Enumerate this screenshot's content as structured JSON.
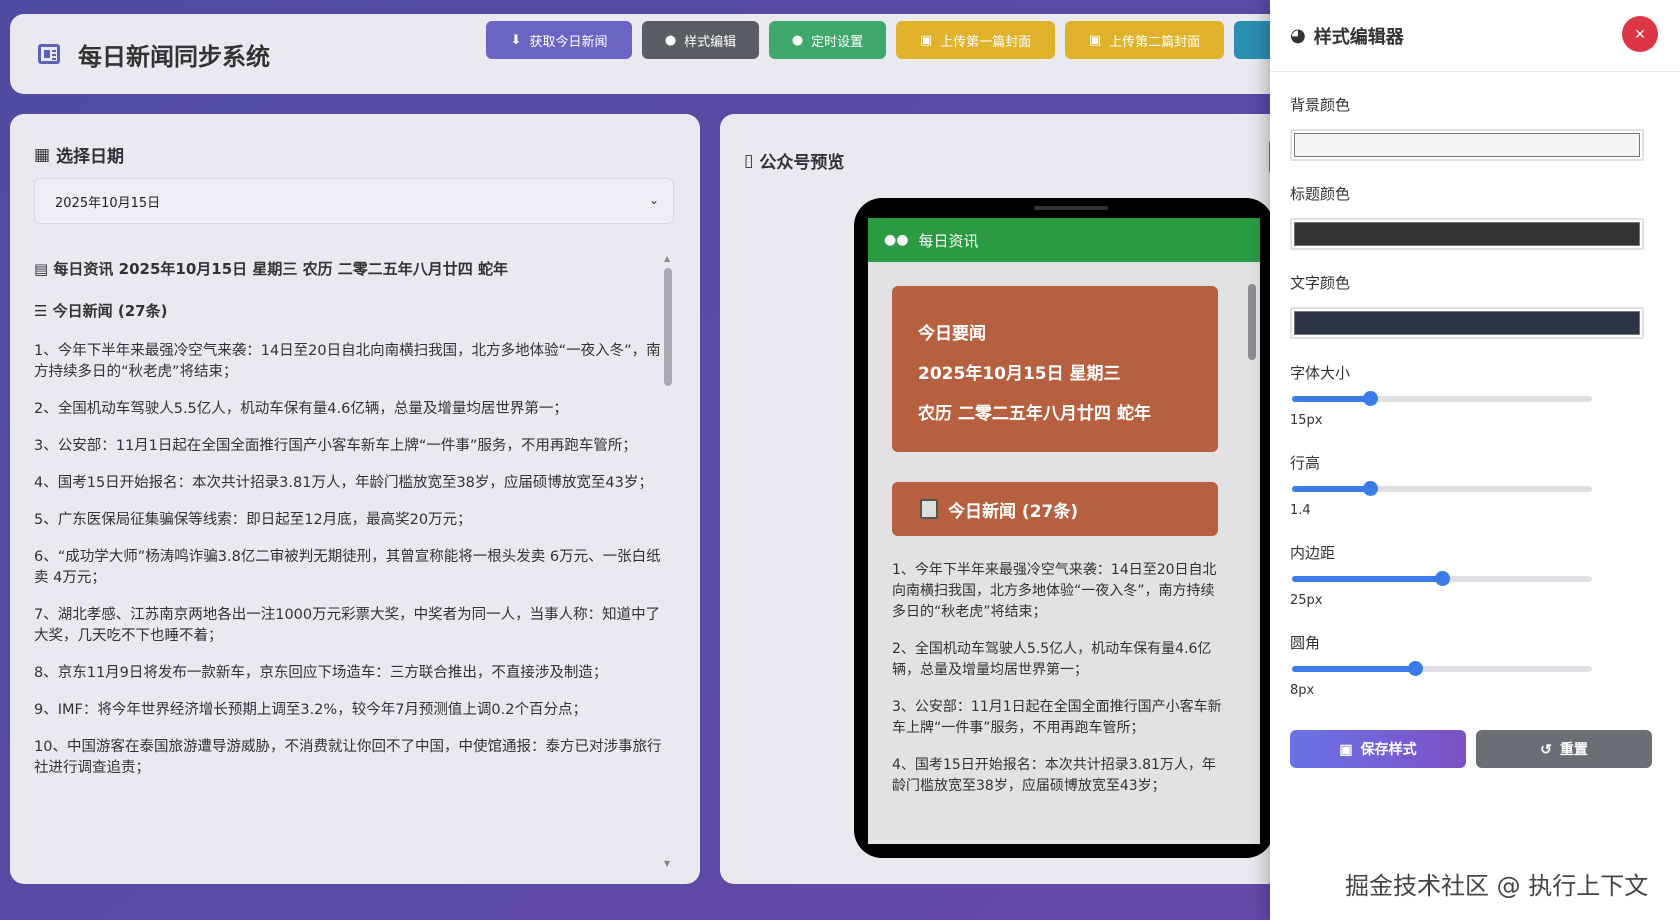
{
  "app": {
    "title": "每日新闻同步系统"
  },
  "toolbar": {
    "fetch": "获取今日新闻",
    "style_edit": "样式编辑",
    "schedule": "定时设置",
    "upload_cover1": "上传第一篇封面",
    "upload_cover2": "上传第二篇封面"
  },
  "left_panel": {
    "title": "选择日期",
    "selected_date": "2025年10月15日",
    "header_line": "每日资讯 2025年10月15日 星期三 农历 二零二五年八月廿四 蛇年",
    "news_heading": "今日新闻 (27条)",
    "items": [
      "1、今年下半年来最强冷空气来袭：14日至20日自北向南横扫我国，北方多地体验“一夜入冬”，南方持续多日的“秋老虎”将结束；",
      "2、全国机动车驾驶人5.5亿人，机动车保有量4.6亿辆，总量及增量均居世界第一；",
      "3、公安部：11月1日起在全国全面推行国产小客车新车上牌“一件事”服务，不用再跑车管所；",
      "4、国考15日开始报名：本次共计招录3.81万人，年龄门槛放宽至38岁，应届硕博放宽至43岁；",
      "5、广东医保局征集骗保等线索：即日起至12月底，最高奖20万元；",
      "6、“成功学大师”杨涛鸣诈骗3.8亿二审被判无期徒刑，其曾宣称能将一根头发卖 6万元、一张白纸卖 4万元；",
      "7、湖北孝感、江苏南京两地各出一注1000万元彩票大奖，中奖者为同一人，当事人称：知道中了大奖，几天吃不下也睡不着；",
      "8、京东11月9日将发布一款新车，京东回应下场造车：三方联合推出，不直接涉及制造；",
      "9、IMF：将今年世界经济增长预期上调至3.2%，较今年7月预测值上调0.2个百分点；",
      "10、中国游客在泰国旅游遭导游威胁，不消费就让你回不了中国，中使馆通报：泰方已对涉事旅行社进行调查追责；"
    ]
  },
  "preview": {
    "title": "公众号预览",
    "account_name": "每日资讯",
    "card_title": "今日要闻",
    "card_date": "2025年10月15日 星期三",
    "card_lunar": "农历 二零二五年八月廿四 蛇年",
    "news_heading": "今日新闻 (27条)",
    "items": [
      "1、今年下半年来最强冷空气来袭：14日至20日自北向南横扫我国，北方多地体验“一夜入冬”，南方持续多日的“秋老虎”将结束；",
      "2、全国机动车驾驶人5.5亿人，机动车保有量4.6亿辆，总量及增量均居世界第一；",
      "3、公安部：11月1日起在全国全面推行国产小客车新车上牌“一件事”服务，不用再跑车管所；",
      "4、国考15日开始报名：本次共计招录3.81万人，年龄门槛放宽至38岁，应届硕博放宽至43岁；"
    ]
  },
  "editor": {
    "title": "样式编辑器",
    "close": "×",
    "bg_color_label": "背景颜色",
    "bg_color": "#f5f5f5",
    "title_color_label": "标题颜色",
    "title_color": "#333333",
    "text_color_label": "文字颜色",
    "text_color": "#2c3448",
    "font_size_label": "字体大小",
    "font_size_value": "15px",
    "font_size_fraction": 0.26,
    "line_height_label": "行高",
    "line_height_value": "1.4",
    "line_height_fraction": 0.26,
    "padding_label": "内边距",
    "padding_value": "25px",
    "padding_fraction": 0.5,
    "radius_label": "圆角",
    "radius_value": "8px",
    "radius_fraction": 0.41,
    "save": "保存样式",
    "reset": "重置"
  },
  "watermark": "掘金技术社区 @ 执行上下文",
  "colors": {
    "accent": "#6a65c3",
    "wechat_green": "#2a9b43",
    "card_brown": "#b7603f",
    "close_red": "#dc3545",
    "slider_blue": "#3a7be8"
  }
}
